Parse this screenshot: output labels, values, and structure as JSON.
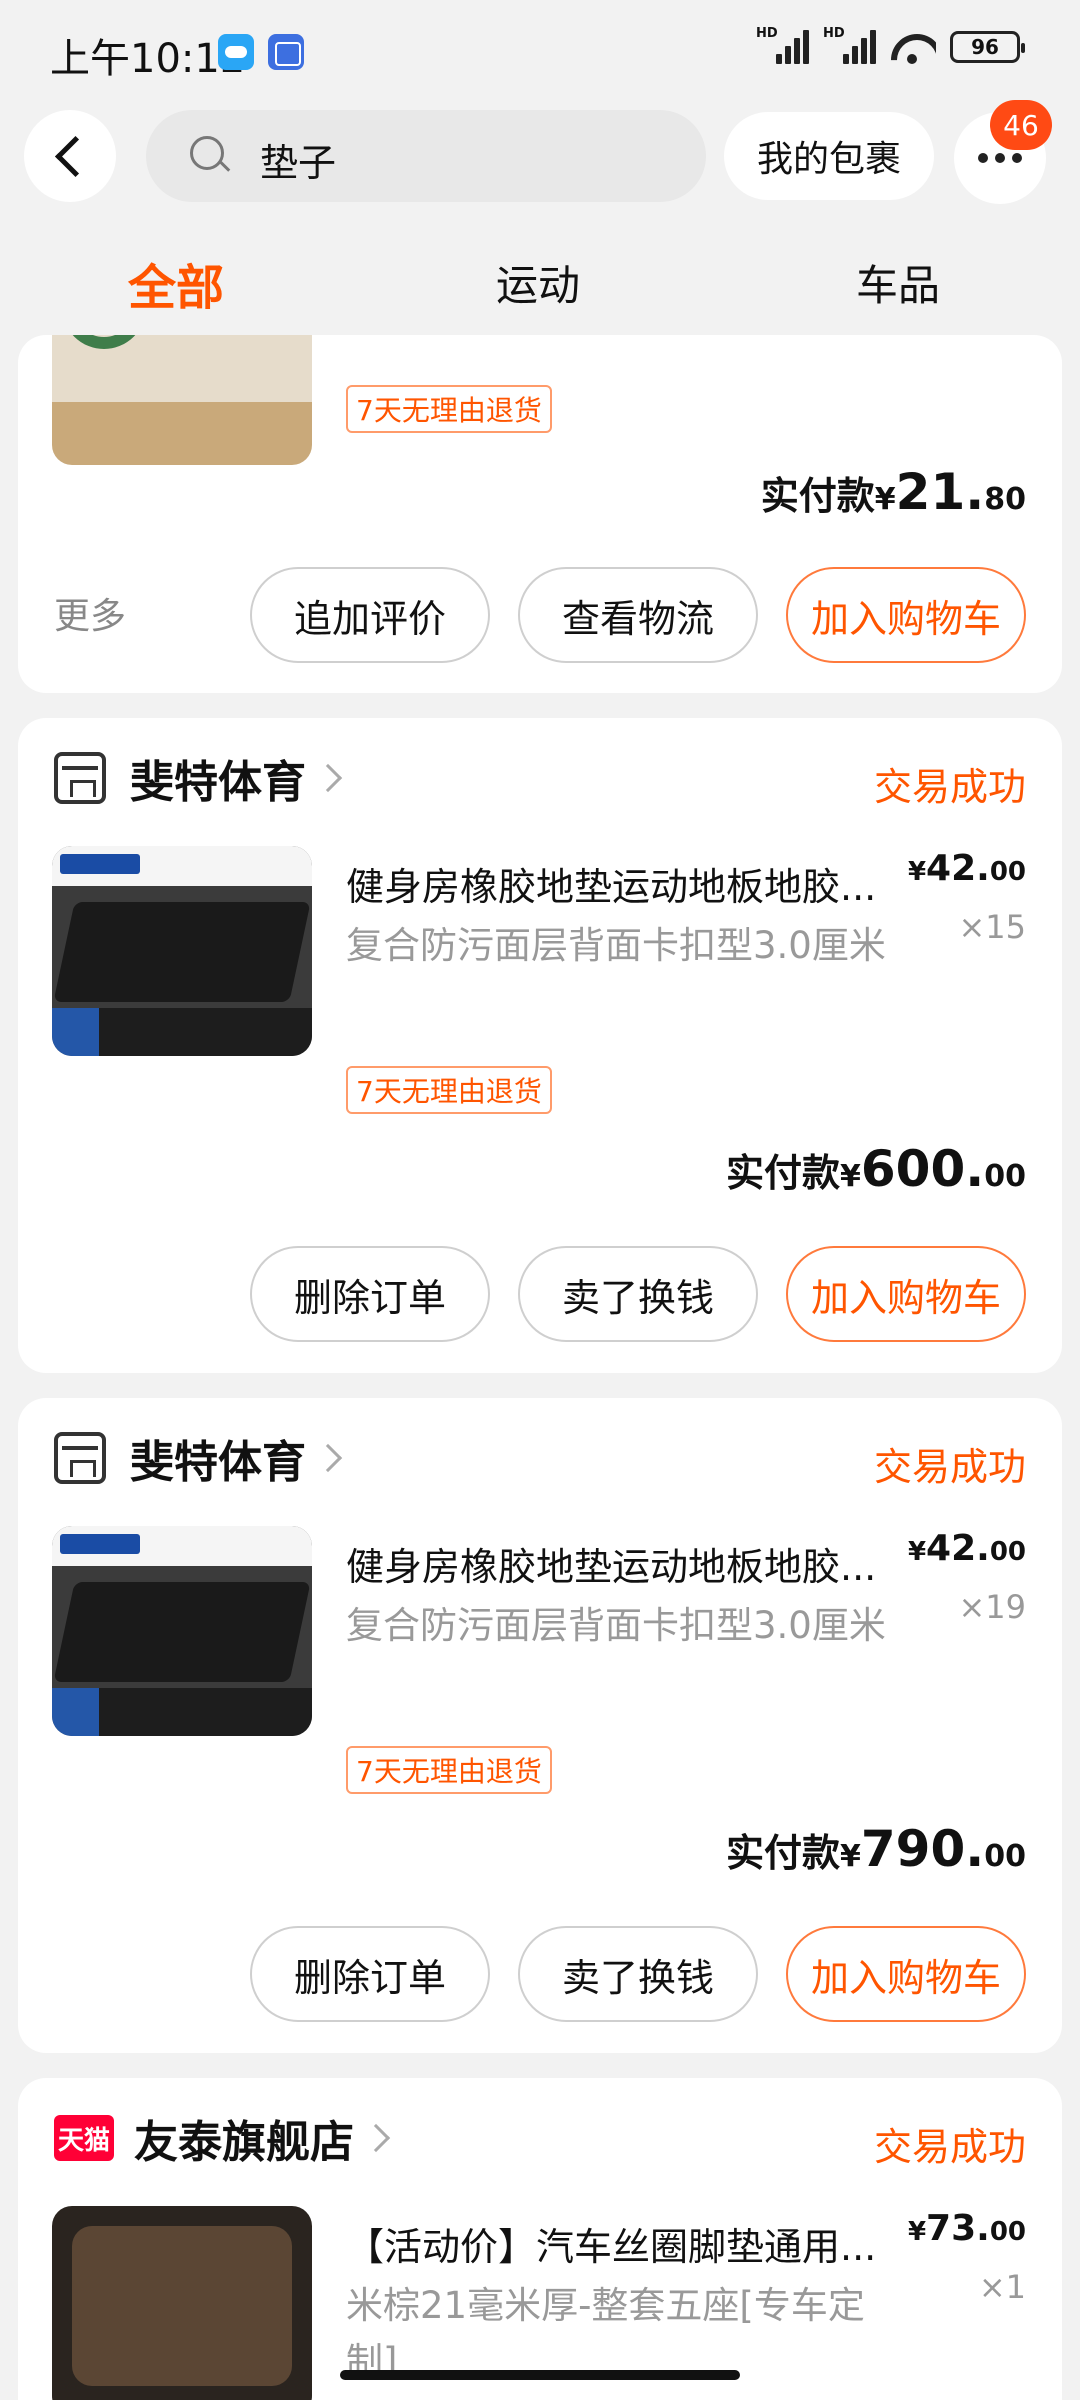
{
  "status_bar": {
    "time": "上午10:12",
    "battery": "96",
    "hd1": "HD",
    "hd2": "HD"
  },
  "header": {
    "search_text": "垫子",
    "package_label": "我的包裹",
    "badge_count": "46"
  },
  "tabs": [
    {
      "label": "全部"
    },
    {
      "label": "运动"
    },
    {
      "label": "车品"
    }
  ],
  "orders": [
    {
      "return_tag": "7天无理由退货",
      "paid_label": "实付款",
      "paid_currency": "¥",
      "paid_int": "21.",
      "paid_dec": "80",
      "more_label": "更多",
      "buttons": [
        "追加评价",
        "查看物流",
        "加入购物车"
      ]
    },
    {
      "shop_name": "斐特体育",
      "status": "交易成功",
      "title": "健身房橡胶地垫运动地板地胶...",
      "spec": "复合防污面层背面卡扣型3.0厘米",
      "return_tag": "7天无理由退货",
      "unit_currency": "¥",
      "unit_int": "42.",
      "unit_dec": "00",
      "qty": "×15",
      "paid_label": "实付款",
      "paid_currency": "¥",
      "paid_int": "600.",
      "paid_dec": "00",
      "buttons": [
        "删除订单",
        "卖了换钱",
        "加入购物车"
      ]
    },
    {
      "shop_name": "斐特体育",
      "status": "交易成功",
      "title": "健身房橡胶地垫运动地板地胶...",
      "spec": "复合防污面层背面卡扣型3.0厘米",
      "return_tag": "7天无理由退货",
      "unit_currency": "¥",
      "unit_int": "42.",
      "unit_dec": "00",
      "qty": "×19",
      "paid_label": "实付款",
      "paid_currency": "¥",
      "paid_int": "790.",
      "paid_dec": "00",
      "buttons": [
        "删除订单",
        "卖了换钱",
        "加入购物车"
      ]
    },
    {
      "shop_badge": "天猫",
      "shop_name": "友泰旗舰店",
      "status": "交易成功",
      "title": "【活动价】汽车丝圈脚垫通用...",
      "spec": "米棕21毫米厚-整套五座[专车定制]",
      "unit_currency": "¥",
      "unit_int": "73.",
      "unit_dec": "00",
      "qty": "×1"
    }
  ],
  "colors": {
    "accent": "#ff5500",
    "badge": "#ff4a14",
    "background": "#f2f2f2",
    "tmall": "#ff0036"
  }
}
